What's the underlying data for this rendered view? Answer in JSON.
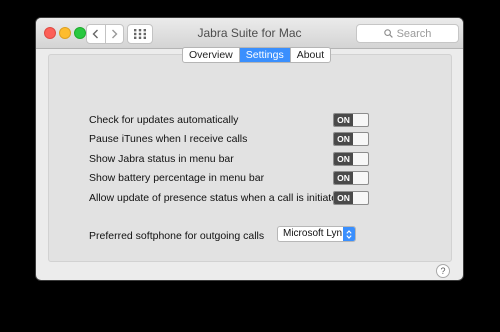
{
  "window": {
    "title": "Jabra Suite for Mac",
    "search_placeholder": "Search"
  },
  "tabs": [
    {
      "label": "Overview",
      "active": false
    },
    {
      "label": "Settings",
      "active": true
    },
    {
      "label": "About",
      "active": false
    }
  ],
  "settings": [
    {
      "label": "Check for updates automatically",
      "toggle": "ON"
    },
    {
      "label": "Pause iTunes when I receive calls",
      "toggle": "ON"
    },
    {
      "label": "Show Jabra status in menu bar",
      "toggle": "ON"
    },
    {
      "label": "Show battery percentage in menu bar",
      "toggle": "ON"
    },
    {
      "label": "Allow update of presence status when a call is initiated",
      "toggle": "ON"
    }
  ],
  "softphone": {
    "label": "Preferred softphone for outgoing calls",
    "selected": "Microsoft Lyn..."
  },
  "help": {
    "label": "?"
  },
  "colors": {
    "accent": "#3a8ffd",
    "toggle_on": "#4a4a4a"
  }
}
